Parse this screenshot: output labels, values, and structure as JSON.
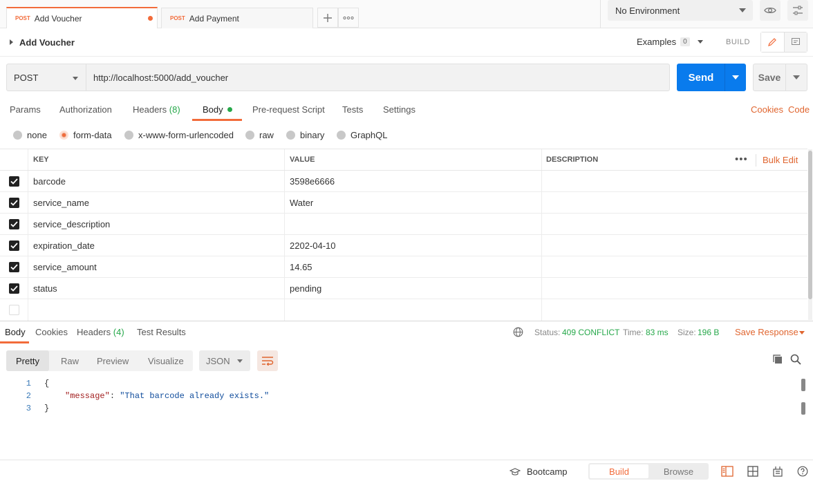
{
  "tabs": [
    {
      "method": "POST",
      "name": "Add Voucher",
      "active": true,
      "dirty": true
    },
    {
      "method": "POST",
      "name": "Add Payment",
      "active": false,
      "dirty": false
    }
  ],
  "environment": {
    "selected": "No Environment"
  },
  "request": {
    "title": "Add Voucher",
    "examples_label": "Examples",
    "examples_count": "0",
    "build_label": "BUILD",
    "method": "POST",
    "url": "http://localhost:5000/add_voucher",
    "send_label": "Send",
    "save_label": "Save"
  },
  "request_tabs": [
    {
      "label": "Params"
    },
    {
      "label": "Authorization"
    },
    {
      "label": "Headers",
      "count": "(8)"
    },
    {
      "label": "Body",
      "active": true
    },
    {
      "label": "Pre-request Script"
    },
    {
      "label": "Tests"
    },
    {
      "label": "Settings"
    }
  ],
  "request_links": {
    "cookies": "Cookies",
    "code": "Code"
  },
  "body_types": [
    {
      "label": "none",
      "selected": false
    },
    {
      "label": "form-data",
      "selected": true
    },
    {
      "label": "x-www-form-urlencoded",
      "selected": false
    },
    {
      "label": "raw",
      "selected": false
    },
    {
      "label": "binary",
      "selected": false
    },
    {
      "label": "GraphQL",
      "selected": false
    }
  ],
  "params_table": {
    "headers": {
      "key": "KEY",
      "value": "VALUE",
      "description": "DESCRIPTION"
    },
    "bulk_edit": "Bulk Edit",
    "rows": [
      {
        "checked": true,
        "key": "barcode",
        "value": "3598e6666",
        "description": ""
      },
      {
        "checked": true,
        "key": "service_name",
        "value": "Water",
        "description": ""
      },
      {
        "checked": true,
        "key": "service_description",
        "value": "",
        "description": ""
      },
      {
        "checked": true,
        "key": "expiration_date",
        "value": "2202-04-10",
        "description": ""
      },
      {
        "checked": true,
        "key": "service_amount",
        "value": "14.65",
        "description": ""
      },
      {
        "checked": true,
        "key": "status",
        "value": "pending",
        "description": ""
      },
      {
        "checked": false,
        "key": "",
        "value": "",
        "description": ""
      }
    ]
  },
  "response": {
    "tabs": [
      {
        "label": "Body",
        "active": true
      },
      {
        "label": "Cookies"
      },
      {
        "label": "Headers",
        "count": "(4)"
      },
      {
        "label": "Test Results"
      }
    ],
    "status_label": "Status:",
    "status_value": "409 CONFLICT",
    "time_label": "Time:",
    "time_value": "83 ms",
    "size_label": "Size:",
    "size_value": "196 B",
    "save_response": "Save Response",
    "view_modes": [
      "Pretty",
      "Raw",
      "Preview",
      "Visualize"
    ],
    "format": "JSON",
    "code_lines": [
      {
        "num": "1",
        "text": "{"
      },
      {
        "num": "2",
        "key": "\"message\"",
        "colon": ": ",
        "value": "\"That barcode already exists.\""
      },
      {
        "num": "3",
        "text": "}"
      }
    ]
  },
  "statusbar": {
    "bootcamp": "Bootcamp",
    "build": "Build",
    "browse": "Browse"
  },
  "colors": {
    "accent": "#f26b3a",
    "primary": "#097bed",
    "success": "#26a84a"
  }
}
